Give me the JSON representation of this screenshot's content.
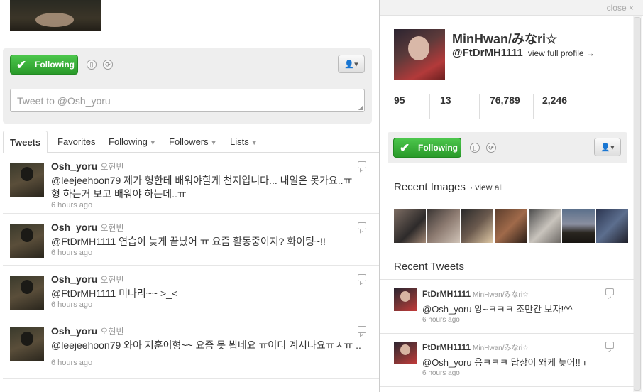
{
  "left": {
    "follow_label": "Following",
    "tweet_placeholder": "Tweet to @Osh_yoru",
    "tabs": [
      {
        "label": "Tweets"
      },
      {
        "label": "Favorites"
      },
      {
        "label": "Following"
      },
      {
        "label": "Followers"
      },
      {
        "label": "Lists"
      }
    ],
    "tweets": [
      {
        "user": "Osh_yoru",
        "fullname": "오현빈",
        "text": "@leejeehoon79 제가 형한테 배워야할게 천지입니다... 내일은 못가요..ㅠ 형 하는거 보고 배워야 하는데..ㅠ",
        "time": "6 hours ago"
      },
      {
        "user": "Osh_yoru",
        "fullname": "오현빈",
        "text": "@FtDrMH1111 연습이 늦게 끝났어 ㅠ 요즘 활동중이지? 화이팅~!!",
        "time": "6 hours ago"
      },
      {
        "user": "Osh_yoru",
        "fullname": "오현빈",
        "text": "@FtDrMH1111 미나리~~ >_<",
        "time": "6 hours ago"
      },
      {
        "user": "Osh_yoru",
        "fullname": "오현빈",
        "text": "@leejeehoon79 와아 지훈이형~~ 요즘 못 뵙네요 ㅠ어디 계시나요ㅠㅅㅠ ..",
        "time": "6 hours ago"
      }
    ]
  },
  "panel": {
    "close_label": "close",
    "close_glyph": "×",
    "name": "MinHwan/みなri☆",
    "handle": "@FtDrMH1111",
    "view_full_profile": "view full profile →",
    "stats": [
      "95",
      "13",
      "76,789",
      "2,246"
    ],
    "follow_label": "Following",
    "recent_images_title": "Recent Images",
    "view_all": "· view all",
    "recent_tweets_title": "Recent Tweets",
    "recent_tweets": [
      {
        "user": "FtDrMH1111",
        "fullname": "MinHwan/みなri☆",
        "text": "@Osh_yoru 앙~ㅋㅋㅋ 조만간 보자!^^",
        "time": "6 hours ago"
      },
      {
        "user": "FtDrMH1111",
        "fullname": "MinHwan/みなri☆",
        "text": "@Osh_yoru 응ㅋㅋㅋ 답장이 왜케 늦어!!ㅜ",
        "time": "6 hours ago"
      }
    ]
  },
  "icons": {
    "check": "✔",
    "caret": "▼",
    "user_menu": "👤▾"
  },
  "colors": {
    "follow_green": "#2a9a2a",
    "muted_text": "#999999",
    "panel_bg": "#eeeeee"
  }
}
